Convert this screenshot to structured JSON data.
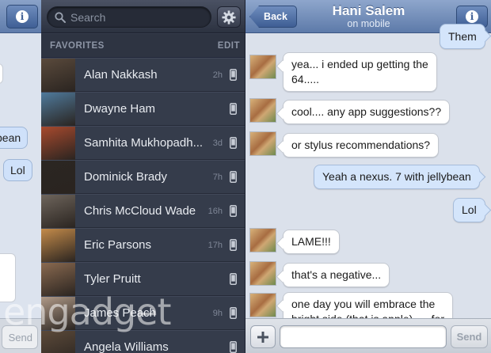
{
  "left_strip": {
    "bubbles": [
      "bean",
      "Lol"
    ],
    "send_label": "Send"
  },
  "friends_panel": {
    "search": {
      "placeholder": "Search"
    },
    "favorites_label": "FAVORITES",
    "edit_label": "EDIT",
    "friends": [
      {
        "name": "Alan Nakkash",
        "time": "2h",
        "avatar_color": "#5a4a3c"
      },
      {
        "name": "Dwayne Ham",
        "time": "",
        "avatar_color": "#4f7a9c"
      },
      {
        "name": "Samhita Mukhopadh...",
        "time": "3d",
        "avatar_color": "#a84a2e"
      },
      {
        "name": "Dominick Brady",
        "time": "7h",
        "avatar_color": "#2b2622"
      },
      {
        "name": "Chris McCloud Wade",
        "time": "16h",
        "avatar_color": "#6e655c"
      },
      {
        "name": "Eric Parsons",
        "time": "17h",
        "avatar_color": "#c48b4a"
      },
      {
        "name": "Tyler Pruitt",
        "time": "",
        "avatar_color": "#8a6a50"
      },
      {
        "name": "James Peach",
        "time": "9h",
        "avatar_color": "#b09a88"
      },
      {
        "name": "Angela Williams",
        "time": "",
        "avatar_color": "#5c4a3a"
      }
    ]
  },
  "chat": {
    "back_label": "Back",
    "contact_name": "Hani Salem",
    "contact_status": "on mobile",
    "messages": [
      {
        "from": "me",
        "text": "Them"
      },
      {
        "from": "them",
        "text": "yea... i ended up getting the",
        "text2": "64....."
      },
      {
        "from": "them",
        "text": "cool.... any app suggestions??"
      },
      {
        "from": "them",
        "text": "or stylus recommendations?"
      },
      {
        "from": "me",
        "text": "Yeah a nexus. 7 with jellybean"
      },
      {
        "from": "me",
        "text": "Lol"
      },
      {
        "from": "them",
        "text": "LAME!!!"
      },
      {
        "from": "them",
        "text": "that's a negative..."
      },
      {
        "from": "them",
        "text": "one day you will embrace the",
        "text2": "bright side (that is apple)..... for"
      }
    ],
    "composer": {
      "placeholder": "",
      "send_label": "Send"
    }
  },
  "watermark": "engadget",
  "colors": {
    "header_blue": "#6f8cbb",
    "list_bg": "#353c4b",
    "outgoing_bubble": "#d4e5fb",
    "incoming_bubble": "#ffffff"
  }
}
